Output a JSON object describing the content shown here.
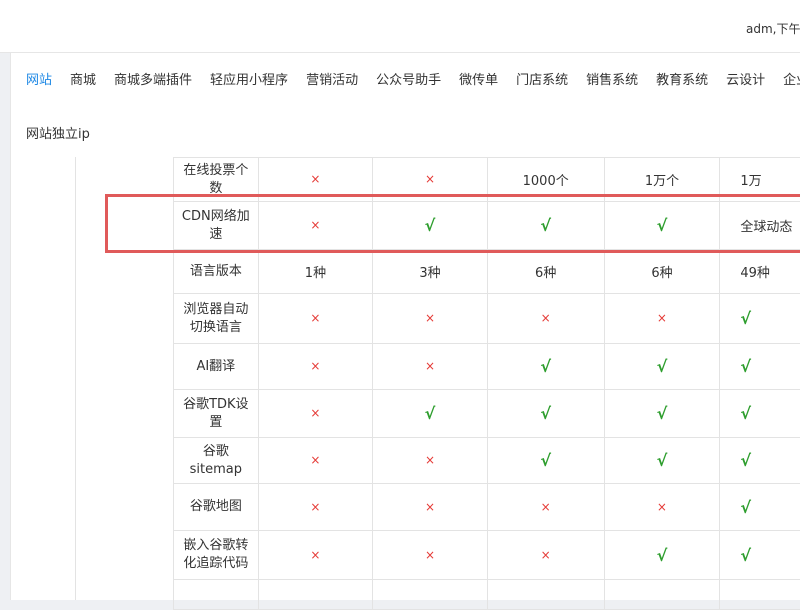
{
  "header": {
    "user_greeting": "adm,下午好"
  },
  "nav": {
    "tabs": [
      {
        "label": "网站",
        "active": true
      },
      {
        "label": "商城",
        "active": false
      },
      {
        "label": "商城多端插件",
        "active": false
      },
      {
        "label": "轻应用小程序",
        "active": false
      },
      {
        "label": "营销活动",
        "active": false
      },
      {
        "label": "公众号助手",
        "active": false
      },
      {
        "label": "微传单",
        "active": false
      },
      {
        "label": "门店系统",
        "active": false
      },
      {
        "label": "销售系统",
        "active": false
      },
      {
        "label": "教育系统",
        "active": false
      },
      {
        "label": "云设计",
        "active": false
      },
      {
        "label": "企业",
        "active": false
      }
    ],
    "sub_tab": "网站独立ip"
  },
  "colors": {
    "accent": "#1e88e5",
    "cross": "#e53935",
    "check": "#2e9e2e",
    "highlight": "#e05a5a"
  },
  "table": {
    "rows": [
      {
        "feature": "在线投票个数",
        "values": [
          "×",
          "×",
          "1000个",
          "1万个",
          "1万"
        ]
      },
      {
        "feature": "CDN网络加速",
        "values": [
          "×",
          "√",
          "√",
          "√",
          "全球动态"
        ],
        "highlighted": true
      },
      {
        "feature": "语言版本",
        "values": [
          "1种",
          "3种",
          "6种",
          "6种",
          "49种"
        ]
      },
      {
        "feature": "浏览器自动切换语言",
        "values": [
          "×",
          "×",
          "×",
          "×",
          "√"
        ]
      },
      {
        "feature": "AI翻译",
        "values": [
          "×",
          "×",
          "√",
          "√",
          "√"
        ]
      },
      {
        "feature": "谷歌TDK设置",
        "values": [
          "×",
          "√",
          "√",
          "√",
          "√"
        ]
      },
      {
        "feature": "谷歌sitemap",
        "values": [
          "×",
          "×",
          "√",
          "√",
          "√"
        ]
      },
      {
        "feature": "谷歌地图",
        "values": [
          "×",
          "×",
          "×",
          "×",
          "√"
        ]
      },
      {
        "feature": "嵌入谷歌转化追踪代码",
        "values": [
          "×",
          "×",
          "×",
          "√",
          "√"
        ]
      },
      {
        "feature": "",
        "values": [
          "",
          "",
          "",
          "",
          ""
        ]
      }
    ]
  }
}
